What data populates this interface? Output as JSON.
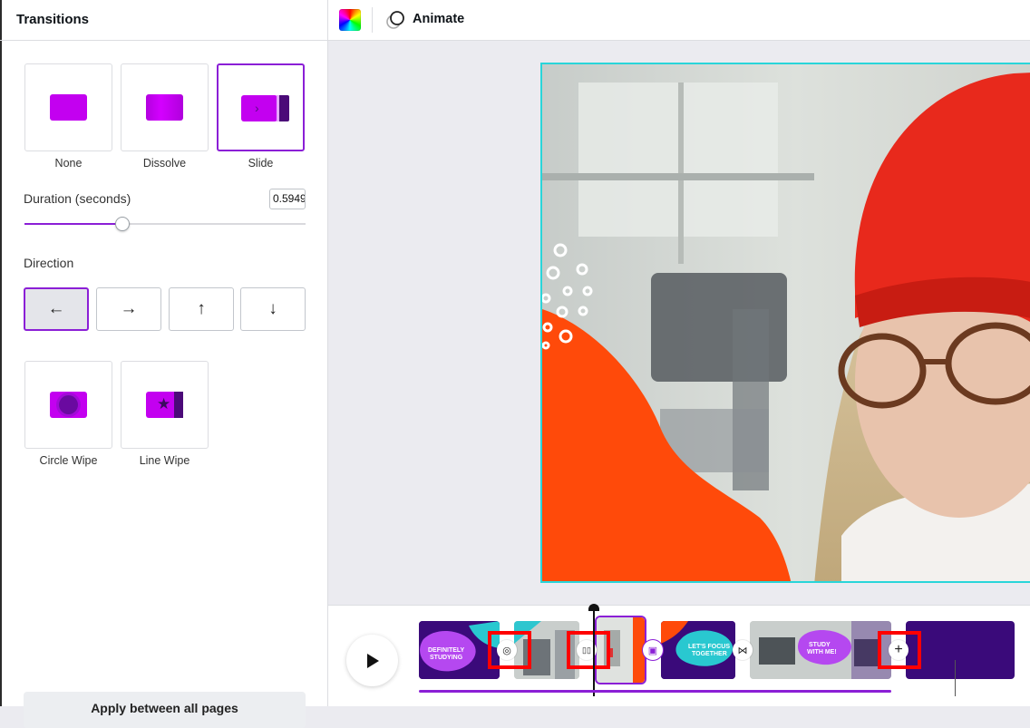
{
  "panel": {
    "title": "Transitions",
    "transitions": [
      {
        "label": "None",
        "selected": false,
        "icon": "none-transition-icon"
      },
      {
        "label": "Dissolve",
        "selected": false,
        "icon": "dissolve-transition-icon"
      },
      {
        "label": "Slide",
        "selected": true,
        "icon": "slide-transition-icon"
      },
      {
        "label": "Circle Wipe",
        "selected": false,
        "icon": "circle-wipe-transition-icon"
      },
      {
        "label": "Line Wipe",
        "selected": false,
        "icon": "line-wipe-transition-icon"
      }
    ],
    "duration": {
      "label": "Duration (seconds)",
      "value": "0.5949",
      "slider_fraction": 0.35
    },
    "direction": {
      "label": "Direction",
      "options": [
        {
          "icon": "arrow-left-icon",
          "glyph": "←",
          "active": true
        },
        {
          "icon": "arrow-right-icon",
          "glyph": "→",
          "active": false
        },
        {
          "icon": "arrow-up-icon",
          "glyph": "↑",
          "active": false
        },
        {
          "icon": "arrow-down-icon",
          "glyph": "↓",
          "active": false
        }
      ]
    },
    "apply_label": "Apply between all pages"
  },
  "toolbar": {
    "animate_label": "Animate"
  },
  "timeline": {
    "clips": [
      {
        "name": "clip-1",
        "texts": [
          "DEFINITELY",
          "STUDYING"
        ]
      },
      {
        "name": "clip-2",
        "texts": []
      },
      {
        "name": "clip-3",
        "texts": [],
        "selected": true
      },
      {
        "name": "clip-4",
        "texts": [
          "LET'S FOCUS",
          "TOGETHER"
        ]
      },
      {
        "name": "clip-5",
        "texts": [
          "STUDY",
          "WITH ME!"
        ]
      },
      {
        "name": "clip-6",
        "texts": []
      }
    ],
    "transition_glyphs": [
      "◎",
      "▯▯",
      "▣",
      "⋈",
      "+"
    ]
  },
  "colors": {
    "accent": "#8b1fd6",
    "selection_border": "#29d5d9",
    "annotation_red": "#ff0000",
    "brand_purple": "#c300f0",
    "orange_blob": "#ff4a0a"
  }
}
